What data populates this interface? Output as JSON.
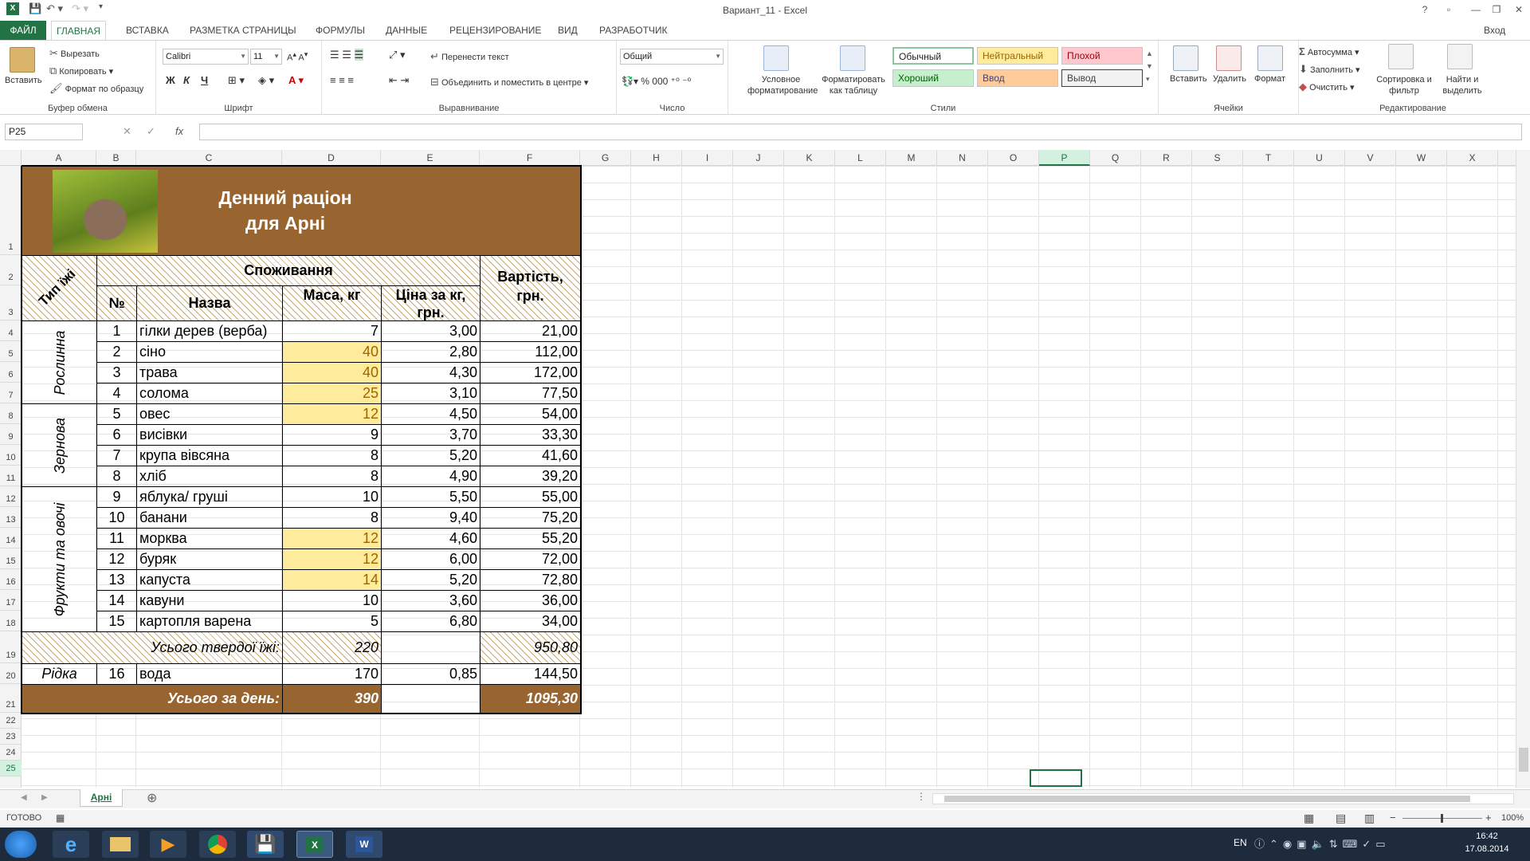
{
  "window": {
    "title": "Вариант_11 - Excel",
    "signin": "Вход",
    "controls": [
      "?",
      "▫",
      "—",
      "❐",
      "✕"
    ]
  },
  "tabs": [
    {
      "label": "ФАЙЛ"
    },
    {
      "label": "ГЛАВНАЯ"
    },
    {
      "label": "ВСТАВКА"
    },
    {
      "label": "РАЗМЕТКА СТРАНИЦЫ"
    },
    {
      "label": "ФОРМУЛЫ"
    },
    {
      "label": "ДАННЫЕ"
    },
    {
      "label": "РЕЦЕНЗИРОВАНИЕ"
    },
    {
      "label": "ВИД"
    },
    {
      "label": "РАЗРАБОТЧИК"
    }
  ],
  "ribbon": {
    "clipboard": {
      "paste": "Вставить",
      "cut": "Вырезать",
      "copy": "Копировать",
      "format_painter": "Формат по образцу",
      "label": "Буфер обмена"
    },
    "font": {
      "name": "Calibri",
      "size": "11",
      "bold": "Ж",
      "italic": "К",
      "underline": "Ч",
      "label": "Шрифт"
    },
    "alignment": {
      "wrap": "Перенести текст",
      "merge": "Объединить и поместить в центре",
      "label": "Выравнивание"
    },
    "number": {
      "format": "Общий",
      "label": "Число"
    },
    "styles": {
      "conditional": "Условное форматирование",
      "as_table": "Форматировать как таблицу",
      "normal": "Обычный",
      "neutral": "Нейтральный",
      "bad": "Плохой",
      "good": "Хороший",
      "input": "Ввод",
      "output": "Вывод",
      "label": "Стили"
    },
    "cells": {
      "insert": "Вставить",
      "delete": "Удалить",
      "format": "Формат",
      "label": "Ячейки"
    },
    "editing": {
      "autosum": "Автосумма",
      "fill": "Заполнить",
      "clear": "Очистить",
      "sort": "Сортировка и фильтр",
      "find": "Найти и выделить",
      "label": "Редактирование"
    }
  },
  "formula_bar": {
    "name_box": "P25",
    "fx": "fx",
    "value": ""
  },
  "columns": [
    "A",
    "B",
    "C",
    "D",
    "E",
    "F",
    "G",
    "H",
    "I",
    "J",
    "K",
    "L",
    "M",
    "N",
    "O",
    "P",
    "Q",
    "R",
    "S",
    "T",
    "U",
    "V",
    "W",
    "X"
  ],
  "rows": [
    "1",
    "2",
    "3",
    "4",
    "5",
    "6",
    "7",
    "8",
    "9",
    "10",
    "11",
    "12",
    "13",
    "14",
    "15",
    "16",
    "17",
    "18",
    "19",
    "20",
    "21",
    "22",
    "23",
    "24",
    "25"
  ],
  "table": {
    "title_line1": "Денний раціон",
    "title_line2": "для Арні",
    "h_type": "Тип їжі",
    "h_consumption": "Споживання",
    "h_no": "№",
    "h_name": "Назва",
    "h_mass": "Маса, кг",
    "h_price": "Ціна за кг, грн.",
    "h_cost": "Вартість, грн.",
    "groups": {
      "plant": "Рослинна",
      "grain": "Зернова",
      "fruit": "Фрукти та овочі"
    },
    "items": [
      {
        "no": "1",
        "name": "гілки дерев (верба)",
        "mass": "7",
        "price": "3,00",
        "cost": "21,00"
      },
      {
        "no": "2",
        "name": "сіно",
        "mass": "40",
        "price": "2,80",
        "cost": "112,00"
      },
      {
        "no": "3",
        "name": "трава",
        "mass": "40",
        "price": "4,30",
        "cost": "172,00"
      },
      {
        "no": "4",
        "name": "солома",
        "mass": "25",
        "price": "3,10",
        "cost": "77,50"
      },
      {
        "no": "5",
        "name": "овес",
        "mass": "12",
        "price": "4,50",
        "cost": "54,00"
      },
      {
        "no": "6",
        "name": "висівки",
        "mass": "9",
        "price": "3,70",
        "cost": "33,30"
      },
      {
        "no": "7",
        "name": "крупа вівсяна",
        "mass": "8",
        "price": "5,20",
        "cost": "41,60"
      },
      {
        "no": "8",
        "name": "хліб",
        "mass": "8",
        "price": "4,90",
        "cost": "39,20"
      },
      {
        "no": "9",
        "name": "яблука/ груші",
        "mass": "10",
        "price": "5,50",
        "cost": "55,00"
      },
      {
        "no": "10",
        "name": "банани",
        "mass": "8",
        "price": "9,40",
        "cost": "75,20"
      },
      {
        "no": "11",
        "name": "морква",
        "mass": "12",
        "price": "4,60",
        "cost": "55,20"
      },
      {
        "no": "12",
        "name": "буряк",
        "mass": "12",
        "price": "6,00",
        "cost": "72,00"
      },
      {
        "no": "13",
        "name": "капуста",
        "mass": "14",
        "price": "5,20",
        "cost": "72,80"
      },
      {
        "no": "14",
        "name": "кавуни",
        "mass": "10",
        "price": "3,60",
        "cost": "36,00"
      },
      {
        "no": "15",
        "name": "картопля варена",
        "mass": "5",
        "price": "6,80",
        "cost": "34,00"
      }
    ],
    "solid_total": {
      "label": "Усього твердої їжі:",
      "mass": "220",
      "cost": "950,80"
    },
    "liquid": {
      "type": "Рідка",
      "no": "16",
      "name": "вода",
      "mass": "170",
      "price": "0,85",
      "cost": "144,50"
    },
    "day_total": {
      "label": "Усього за день:",
      "mass": "390",
      "cost": "1095,30"
    }
  },
  "sheet_tab": "Арні",
  "status": {
    "ready": "ГОТОВО",
    "zoom": "100%"
  },
  "taskbar": {
    "lang": "EN",
    "time": "16:42",
    "date": "17.08.2014"
  },
  "colors": {
    "excel_green": "#217346",
    "brown": "#986530",
    "yellow": "#ffeb9c"
  }
}
